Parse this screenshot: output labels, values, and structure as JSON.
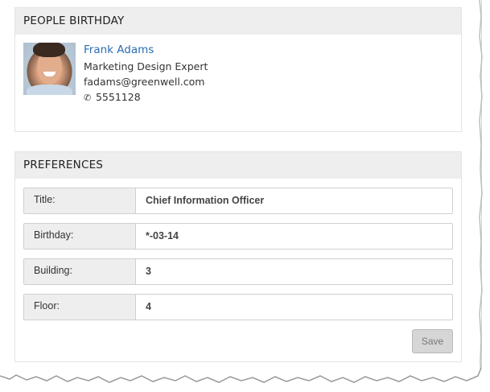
{
  "birthday_panel": {
    "heading": "PEOPLE BIRTHDAY",
    "person": {
      "name": "Frank Adams",
      "title": "Marketing Design Expert",
      "email": "fadams@greenwell.com",
      "phone_icon": "phone-icon",
      "phone": "5551128"
    }
  },
  "preferences_panel": {
    "heading": "PREFERENCES",
    "fields": [
      {
        "label": "Title:",
        "value": "Chief Information Officer"
      },
      {
        "label": "Birthday:",
        "value": "*-03-14"
      },
      {
        "label": "Building:",
        "value": "3"
      },
      {
        "label": "Floor:",
        "value": "4"
      }
    ],
    "save_label": "Save"
  },
  "colors": {
    "link": "#2a6db0",
    "heading_bg": "#eeeeee",
    "button_bg": "#d6d6d6"
  }
}
